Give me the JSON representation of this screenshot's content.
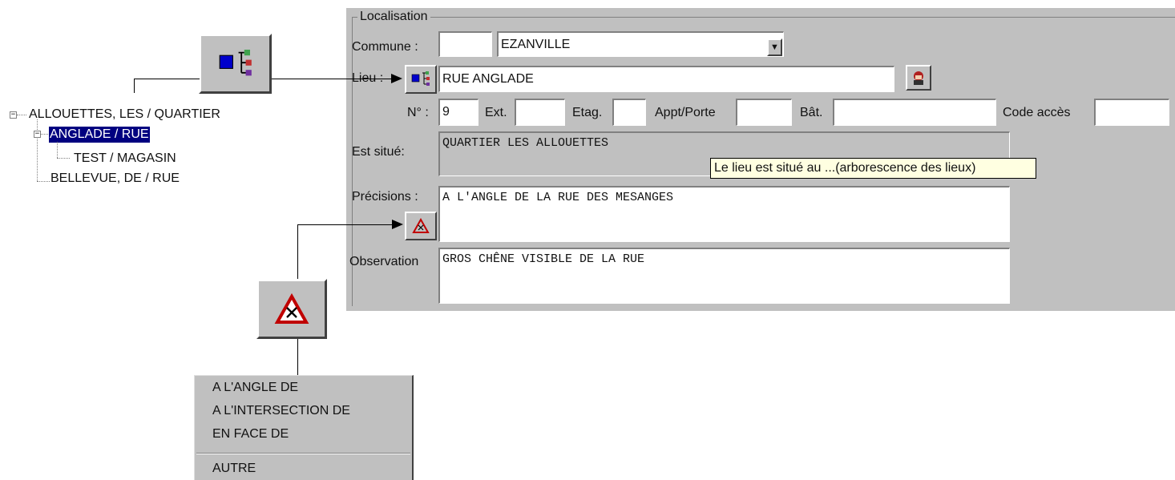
{
  "localisation": {
    "group_title": "Localisation",
    "commune": {
      "label": "Commune :",
      "code_value": "",
      "name_value": "EZANVILLE"
    },
    "lieu": {
      "label": "Lieu :",
      "value": "RUE ANGLADE"
    },
    "address": {
      "numero_label": "N° :",
      "numero_value": "9",
      "ext_label": "Ext.",
      "ext_value": "",
      "etag_label": "Etag.",
      "etag_value": "",
      "appt_label": "Appt/Porte",
      "appt_value": "",
      "bat_label": "Bât.",
      "bat_value": "",
      "code_label": "Code accès",
      "code_value": ""
    },
    "est_situe": {
      "label": "Est situé:",
      "value": "QUARTIER LES  ALLOUETTES"
    },
    "tooltip": "Le lieu est situé au ...(arborescence des lieux)",
    "precisions": {
      "label": "Précisions :",
      "value": "A L'ANGLE DE LA RUE DES MESANGES"
    },
    "observation": {
      "label": "Observation",
      "value": "GROS CHÊNE VISIBLE DE LA RUE"
    }
  },
  "tree": {
    "items": [
      {
        "label": "ALLOUETTES, LES  / QUARTIER",
        "expander": "−"
      },
      {
        "label": "ANGLADE / RUE",
        "expander": "−",
        "selected": true
      },
      {
        "label": "TEST  / MAGASIN"
      },
      {
        "label": "BELLEVUE, DE  / RUE"
      }
    ]
  },
  "context_menu": {
    "items": [
      "A L'ANGLE DE",
      "A L'INTERSECTION DE",
      "EN FACE DE",
      "AUTRE"
    ]
  },
  "icons": {
    "tree_button": "tree-hierarchy-icon",
    "warning_button": "warning-triangle-icon",
    "person_button": "person-icon"
  },
  "colors": {
    "panel": "#c0c0c0",
    "selection": "#000080",
    "tooltip": "#ffffe1"
  }
}
